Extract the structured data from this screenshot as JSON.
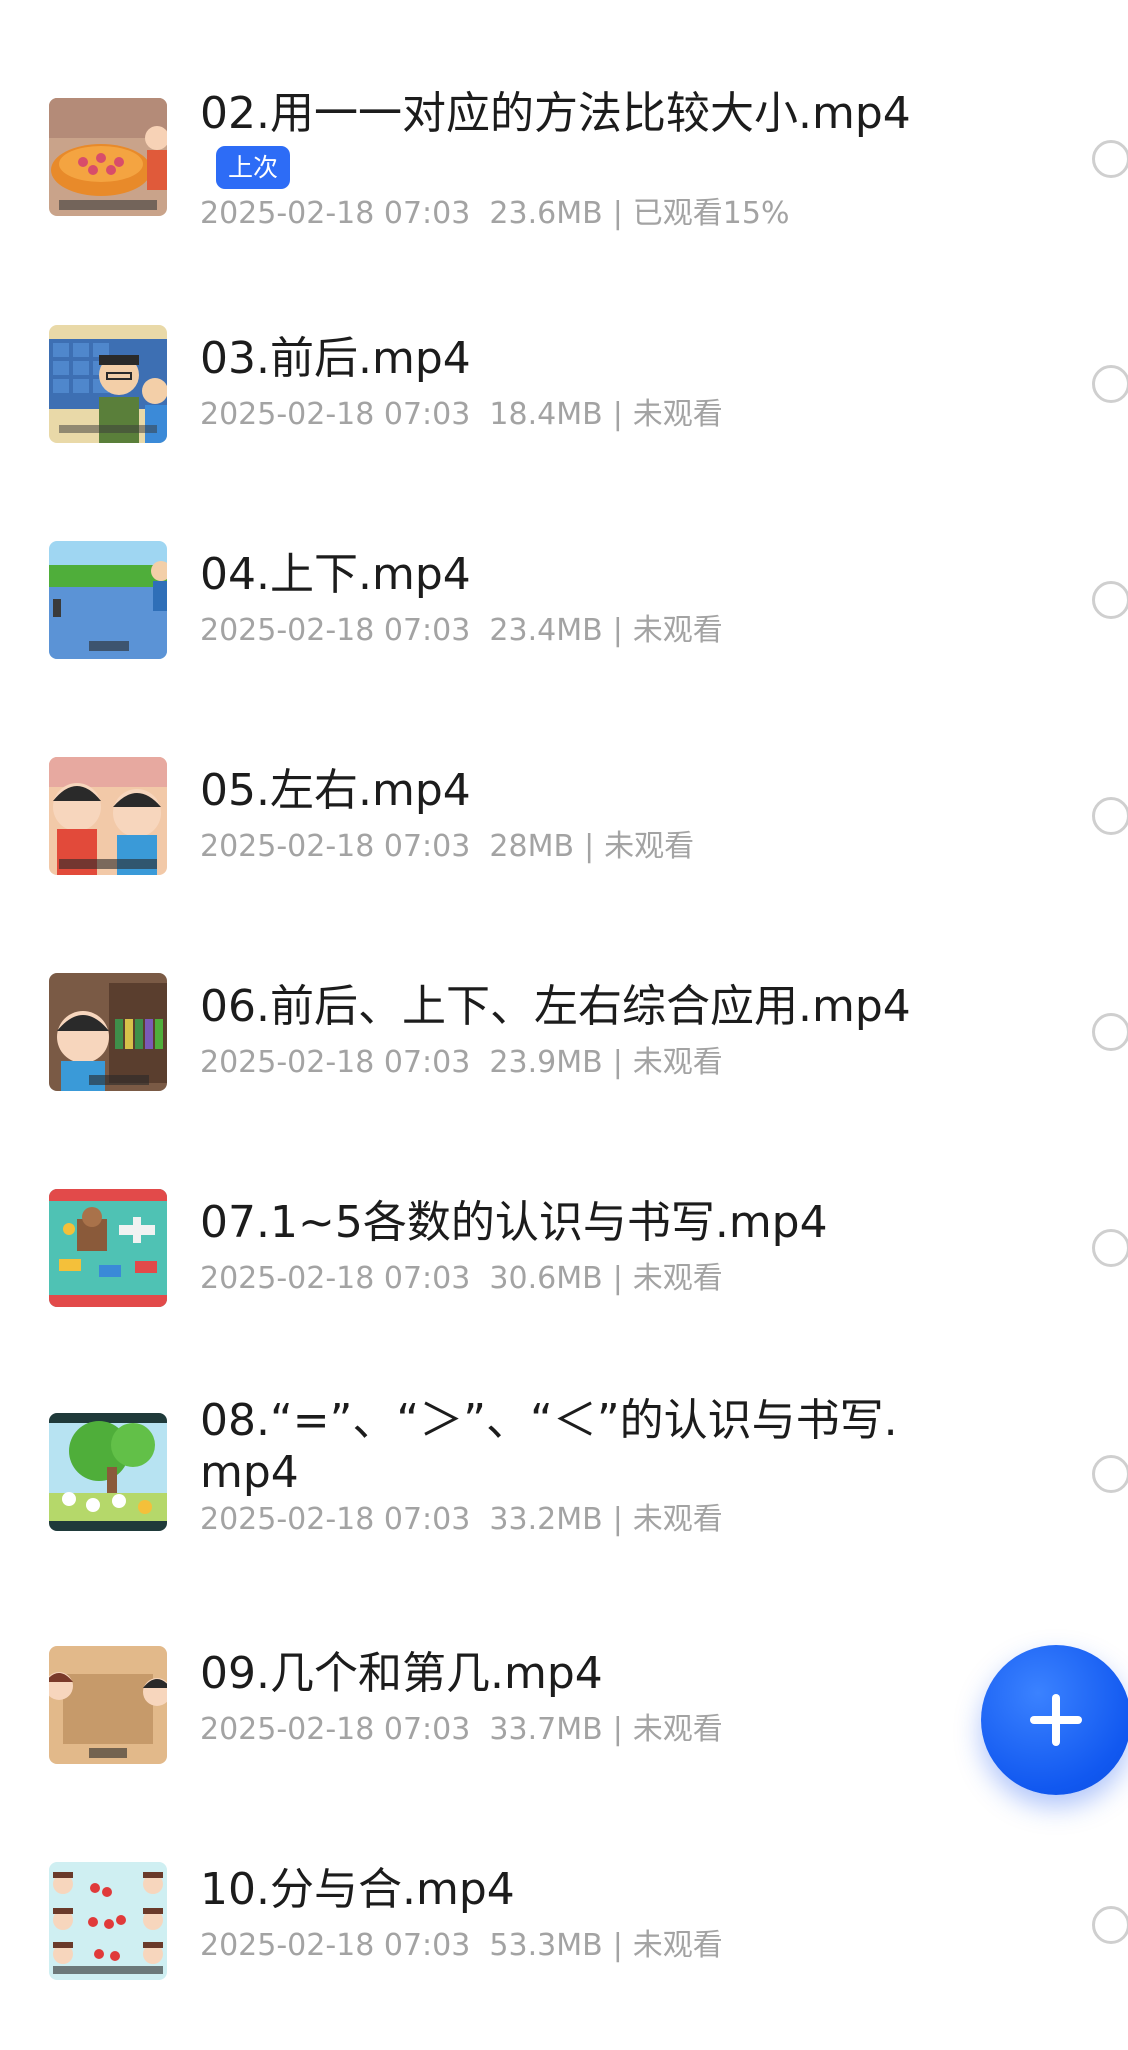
{
  "files": [
    {
      "title": "02.用一一对应的方法比较大小.mp4",
      "badge": "上次",
      "date": "2025-02-18 07:03",
      "size": "23.6MB",
      "status": "已观看15%",
      "thumb_icon": "thumbnail-plate-scene"
    },
    {
      "title": "03.前后.mp4",
      "date": "2025-02-18 07:03",
      "size": "18.4MB",
      "status": "未观看",
      "thumb_icon": "thumbnail-classroom-teacher"
    },
    {
      "title": "04.上下.mp4",
      "date": "2025-02-18 07:03",
      "size": "23.4MB",
      "status": "未观看",
      "thumb_icon": "thumbnail-pond-scene"
    },
    {
      "title": "05.左右.mp4",
      "date": "2025-02-18 07:03",
      "size": "28MB",
      "status": "未观看",
      "thumb_icon": "thumbnail-two-children"
    },
    {
      "title": "06.前后、上下、左右综合应用.mp4",
      "date": "2025-02-18 07:03",
      "size": "23.9MB",
      "status": "未观看",
      "thumb_icon": "thumbnail-bookshelf-child"
    },
    {
      "title": "07.1~5各数的认识与书写.mp4",
      "date": "2025-02-18 07:03",
      "size": "30.6MB",
      "status": "未观看",
      "thumb_icon": "thumbnail-toys-scene"
    },
    {
      "title": "08.“=”、“＞”、“＜”的认识与书写.mp4",
      "date": "2025-02-18 07:03",
      "size": "33.2MB",
      "status": "未观看",
      "thumb_icon": "thumbnail-tree-animals"
    },
    {
      "title": "09.几个和第几.mp4",
      "date": "2025-02-18 07:03",
      "size": "33.7MB",
      "status": "未观看",
      "thumb_icon": "thumbnail-table-children"
    },
    {
      "title": "10.分与合.mp4",
      "date": "2025-02-18 07:03",
      "size": "53.3MB",
      "status": "未观看",
      "thumb_icon": "thumbnail-children-cherries"
    }
  ],
  "separator": "|",
  "fab_icon": "plus-icon",
  "colors": {
    "accent": "#2d6cf6",
    "title_text": "#1c1c1c",
    "meta_text": "#a3a3a3",
    "radio_border": "#cfcfcf"
  }
}
